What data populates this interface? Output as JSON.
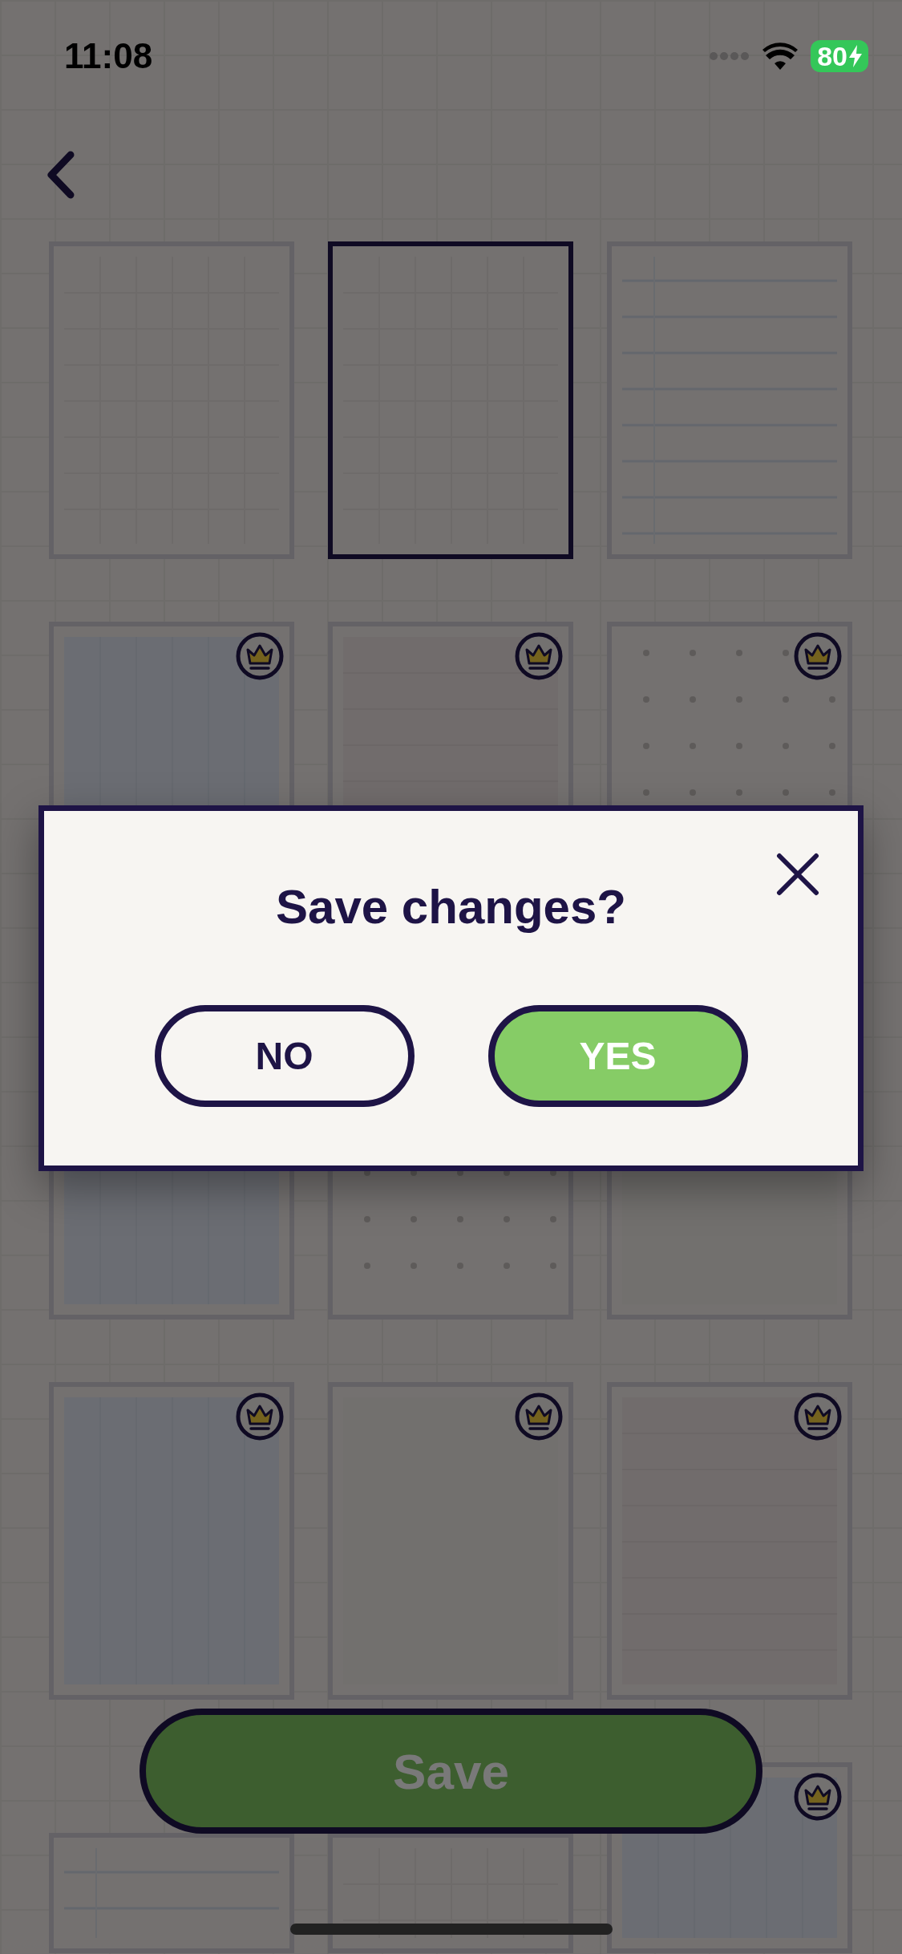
{
  "status_bar": {
    "time": "11:08",
    "battery": "80",
    "charging": true
  },
  "templates": [
    {
      "kind": "grid",
      "selected": false,
      "premium": false
    },
    {
      "kind": "grid",
      "selected": true,
      "premium": false
    },
    {
      "kind": "lined",
      "selected": false,
      "premium": false
    },
    {
      "kind": "blue",
      "selected": false,
      "premium": true
    },
    {
      "kind": "pink",
      "selected": false,
      "premium": true
    },
    {
      "kind": "dots",
      "selected": false,
      "premium": true
    },
    {
      "kind": "blue",
      "selected": false,
      "premium": false
    },
    {
      "kind": "dots",
      "selected": false,
      "premium": false
    },
    {
      "kind": "blank",
      "selected": false,
      "premium": false
    },
    {
      "kind": "blue",
      "selected": false,
      "premium": true
    },
    {
      "kind": "blank",
      "selected": false,
      "premium": true
    },
    {
      "kind": "pink",
      "selected": false,
      "premium": true
    },
    {
      "kind": "lined",
      "selected": false,
      "premium": false
    },
    {
      "kind": "grid",
      "selected": false,
      "premium": false
    },
    {
      "kind": "blue",
      "selected": false,
      "premium": true
    }
  ],
  "save_button": {
    "label": "Save"
  },
  "dialog": {
    "title": "Save changes?",
    "buttons": [
      {
        "label": "NO",
        "kind": "secondary"
      },
      {
        "label": "YES",
        "kind": "primary"
      }
    ]
  }
}
